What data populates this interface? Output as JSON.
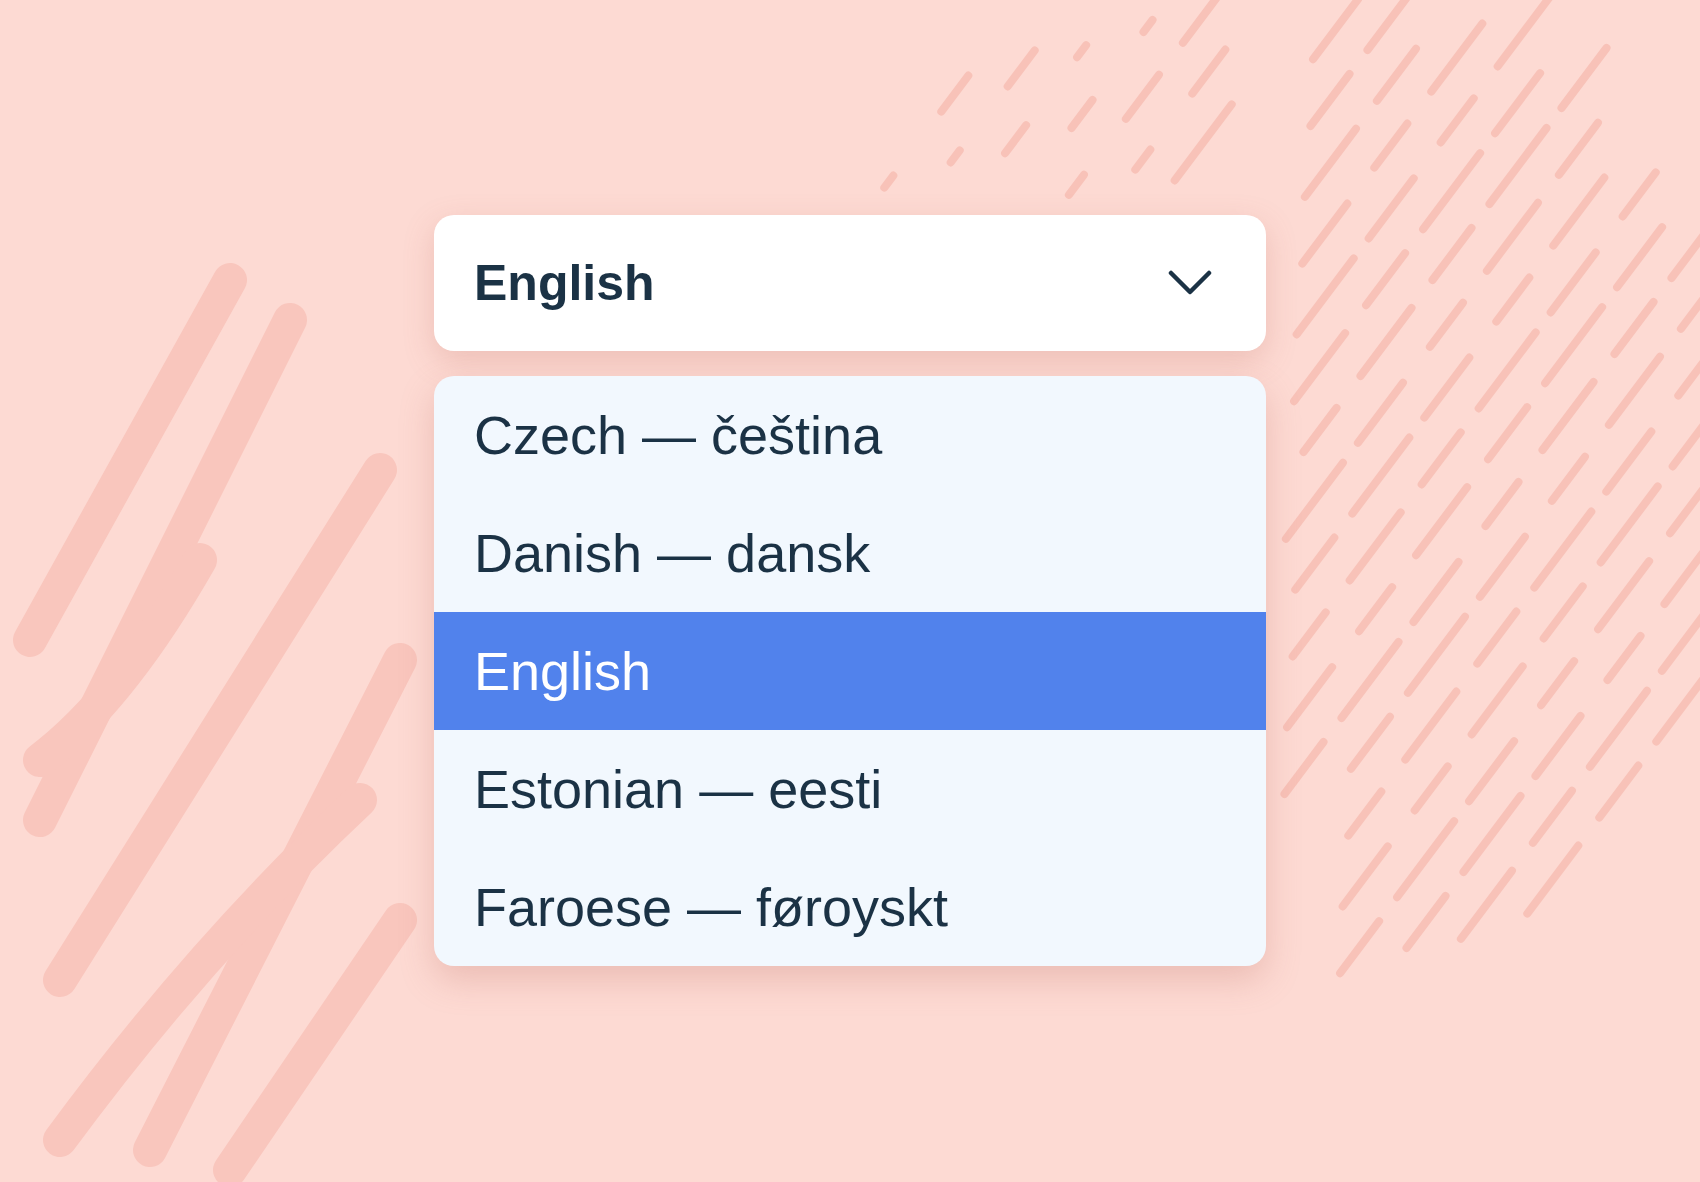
{
  "select": {
    "value": "English",
    "expanded": true
  },
  "options": [
    {
      "label": "Czech — čeština",
      "selected": false
    },
    {
      "label": "Danish — dansk",
      "selected": false
    },
    {
      "label": "English",
      "selected": true
    },
    {
      "label": "Estonian — eesti",
      "selected": false
    },
    {
      "label": "Faroese — føroyskt",
      "selected": false
    }
  ]
}
